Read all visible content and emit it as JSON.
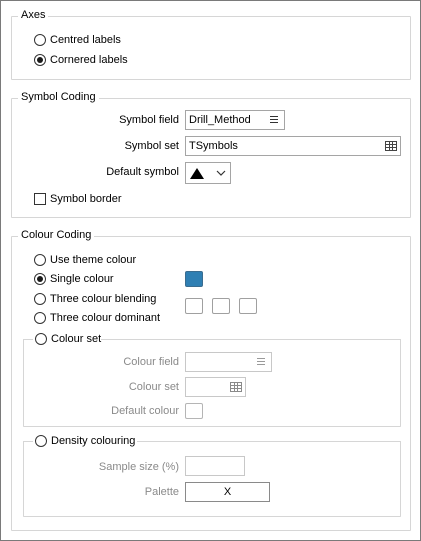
{
  "axes": {
    "title": "Axes",
    "options": [
      {
        "label": "Centred labels",
        "selected": false
      },
      {
        "label": "Cornered labels",
        "selected": true
      }
    ]
  },
  "symbol_coding": {
    "title": "Symbol Coding",
    "symbol_field_label": "Symbol field",
    "symbol_field_value": "Drill_Method",
    "symbol_set_label": "Symbol set",
    "symbol_set_value": "TSymbols",
    "default_symbol_label": "Default symbol",
    "symbol_border_label": "Symbol border",
    "symbol_border_checked": false
  },
  "colour_coding": {
    "title": "Colour Coding",
    "use_theme_colour": "Use theme colour",
    "single_colour": "Single colour",
    "three_colour_blending": "Three colour blending",
    "three_colour_dominant": "Three colour dominant",
    "selected_option": "Single colour",
    "single_colour_value": "#2f7fb3",
    "colour_set": {
      "title": "Colour set",
      "colour_field_label": "Colour field",
      "colour_field_value": "",
      "colour_set_label": "Colour set",
      "colour_set_value": "",
      "default_colour_label": "Default colour"
    },
    "density_colouring": {
      "title": "Density colouring",
      "sample_size_label": "Sample size (%)",
      "sample_size_value": "",
      "palette_label": "Palette",
      "palette_value": "X"
    }
  }
}
